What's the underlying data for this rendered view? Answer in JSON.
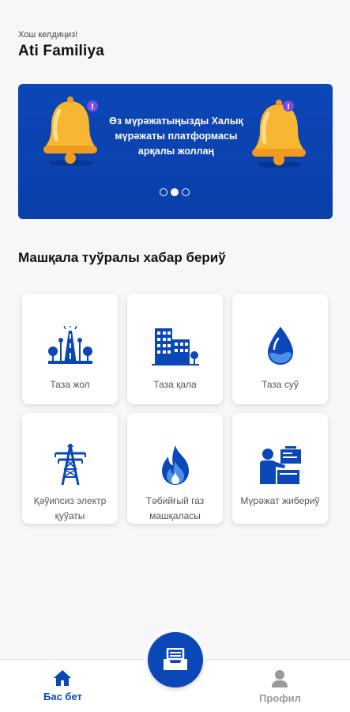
{
  "header": {
    "greeting": "Хош келдиңиз!",
    "username": "Ati Familiya"
  },
  "banner": {
    "text": "Өз мүрәжатыңызды Халық мүрәжаты платформасы арқалы жоллаң",
    "slides_total": 3,
    "active_slide": 2,
    "badge_symbol": "!"
  },
  "section": {
    "title": "Машқала туўралы хабар бериў"
  },
  "categories": [
    {
      "label": "Таза жол",
      "icon": "road-icon"
    },
    {
      "label": "Таза қала",
      "icon": "buildings-icon"
    },
    {
      "label": "Таза суў",
      "icon": "water-drop-icon"
    },
    {
      "label": "Қәўипсиз электр қуўаты",
      "icon": "power-tower-icon"
    },
    {
      "label": "Тәбийғый газ машқаласы",
      "icon": "gas-flame-icon"
    },
    {
      "label": "Мүрәжат жибериў",
      "icon": "presenter-icon"
    }
  ],
  "bottom_nav": {
    "home_label": "Бас бет",
    "profile_label": "Профил",
    "center_icon": "inbox-tray-icon"
  },
  "colors": {
    "accent": "#0c47b7",
    "inactive": "#9a9a9a",
    "bell": "#f7b733"
  }
}
